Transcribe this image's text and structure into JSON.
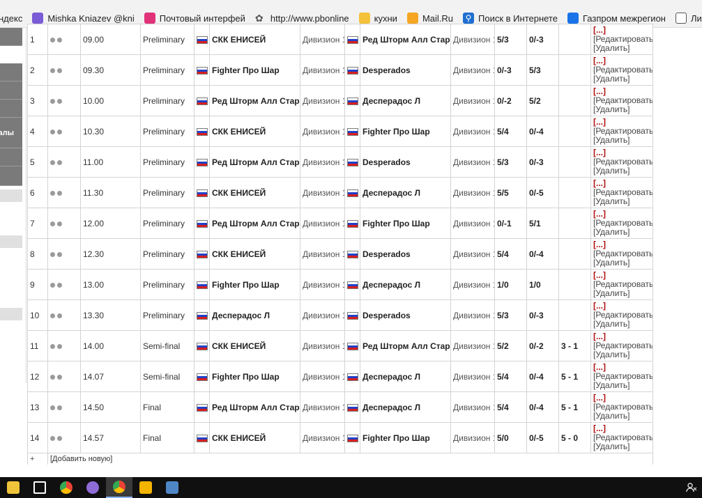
{
  "bookmarks": [
    {
      "label": "ндекс",
      "icon": "yandex-icon"
    },
    {
      "label": "Mishka Kniazev @kni",
      "icon": "viber-heart-icon"
    },
    {
      "label": "Почтовый интерфей",
      "icon": "mail-interface-icon"
    },
    {
      "label": "http://www.pbonline",
      "icon": "globe-icon"
    },
    {
      "label": "кухни",
      "icon": "folder-icon"
    },
    {
      "label": "Mail.Ru",
      "icon": "mailru-icon"
    },
    {
      "label": "Поиск в Интернете",
      "icon": "search-icon"
    },
    {
      "label": "Газпром межрегион",
      "icon": "gazprom-flame-icon"
    },
    {
      "label": "Личный к",
      "icon": "page-icon"
    }
  ],
  "sidebar": {
    "label": "алы"
  },
  "colors": {
    "flag_white": "#ffffff",
    "flag_blue": "#2040c8",
    "flag_red": "#d81e1e",
    "action_more": "#b01010",
    "sidebar_dark": "#7a7a7a",
    "taskbar": "#101010"
  },
  "actions": {
    "more": "[...]",
    "edit": "[Редактировать]",
    "delete": "[Удалить]"
  },
  "add_row": {
    "plus": "+",
    "add_new": "[Добавить новую]"
  },
  "games": [
    {
      "num": "1",
      "time": "09.00",
      "stage": "Preliminary",
      "team1": "СКК ЕНИСЕЙ",
      "div1": "Дивизион 1",
      "team2": "Ред Шторм Алл Старз",
      "div2": "Дивизион 1",
      "score1": "5/3",
      "score2": "0/-3",
      "result": ""
    },
    {
      "num": "2",
      "time": "09.30",
      "stage": "Preliminary",
      "team1": "Fighter Про Шар",
      "div1": "Дивизион 1",
      "team2": "Desperados",
      "div2": "Дивизион 1",
      "score1": "0/-3",
      "score2": "5/3",
      "result": ""
    },
    {
      "num": "3",
      "time": "10.00",
      "stage": "Preliminary",
      "team1": "Ред Шторм Алл Старз",
      "div1": "Дивизион 1",
      "team2": "Десперадос Л",
      "div2": "Дивизион 1",
      "score1": "0/-2",
      "score2": "5/2",
      "result": ""
    },
    {
      "num": "4",
      "time": "10.30",
      "stage": "Preliminary",
      "team1": "СКК ЕНИСЕЙ",
      "div1": "Дивизион 1",
      "team2": "Fighter Про Шар",
      "div2": "Дивизион 1",
      "score1": "5/4",
      "score2": "0/-4",
      "result": ""
    },
    {
      "num": "5",
      "time": "11.00",
      "stage": "Preliminary",
      "team1": "Ред Шторм Алл Старз",
      "div1": "Дивизион 1",
      "team2": "Desperados",
      "div2": "Дивизион 1",
      "score1": "5/3",
      "score2": "0/-3",
      "result": ""
    },
    {
      "num": "6",
      "time": "11.30",
      "stage": "Preliminary",
      "team1": "СКК ЕНИСЕЙ",
      "div1": "Дивизион 1",
      "team2": "Десперадос Л",
      "div2": "Дивизион 1",
      "score1": "5/5",
      "score2": "0/-5",
      "result": ""
    },
    {
      "num": "7",
      "time": "12.00",
      "stage": "Preliminary",
      "team1": "Ред Шторм Алл Старз",
      "div1": "Дивизион 1",
      "team2": "Fighter Про Шар",
      "div2": "Дивизион 1",
      "score1": "0/-1",
      "score2": "5/1",
      "result": ""
    },
    {
      "num": "8",
      "time": "12.30",
      "stage": "Preliminary",
      "team1": "СКК ЕНИСЕЙ",
      "div1": "Дивизион 1",
      "team2": "Desperados",
      "div2": "Дивизион 1",
      "score1": "5/4",
      "score2": "0/-4",
      "result": ""
    },
    {
      "num": "9",
      "time": "13.00",
      "stage": "Preliminary",
      "team1": "Fighter Про Шар",
      "div1": "Дивизион 1",
      "team2": "Десперадос Л",
      "div2": "Дивизион 1",
      "score1": "1/0",
      "score2": "1/0",
      "result": ""
    },
    {
      "num": "10",
      "time": "13.30",
      "stage": "Preliminary",
      "team1": "Десперадос Л",
      "div1": "Дивизион 1",
      "team2": "Desperados",
      "div2": "Дивизион 1",
      "score1": "5/3",
      "score2": "0/-3",
      "result": ""
    },
    {
      "num": "11",
      "time": "14.00",
      "stage": "Semi-final",
      "team1": "СКК ЕНИСЕЙ",
      "div1": "Дивизион 1",
      "team2": "Ред Шторм Алл Старз",
      "div2": "Дивизион 1",
      "score1": "5/2",
      "score2": "0/-2",
      "result": "3 - 1"
    },
    {
      "num": "12",
      "time": "14.07",
      "stage": "Semi-final",
      "team1": "Fighter Про Шар",
      "div1": "Дивизион 1",
      "team2": "Десперадос Л",
      "div2": "Дивизион 1",
      "score1": "5/4",
      "score2": "0/-4",
      "result": "5 - 1"
    },
    {
      "num": "13",
      "time": "14.50",
      "stage": "Final",
      "team1": "Ред Шторм Алл Старз",
      "div1": "Дивизион 1",
      "team2": "Десперадос Л",
      "div2": "Дивизион 1",
      "score1": "5/4",
      "score2": "0/-4",
      "result": "5 - 1"
    },
    {
      "num": "14",
      "time": "14.57",
      "stage": "Final",
      "team1": "СКК ЕНИСЕЙ",
      "div1": "Дивизион 1",
      "team2": "Fighter Про Шар",
      "div2": "Дивизион 1",
      "score1": "5/0",
      "score2": "0/-5",
      "result": "5 - 0"
    }
  ],
  "taskbar": [
    {
      "icon": "file-explorer-icon"
    },
    {
      "icon": "store-icon"
    },
    {
      "icon": "chrome-icon"
    },
    {
      "icon": "viber-icon"
    },
    {
      "icon": "chrome-active-icon"
    },
    {
      "icon": "mail-app-icon"
    },
    {
      "icon": "snipping-tool-icon"
    }
  ]
}
